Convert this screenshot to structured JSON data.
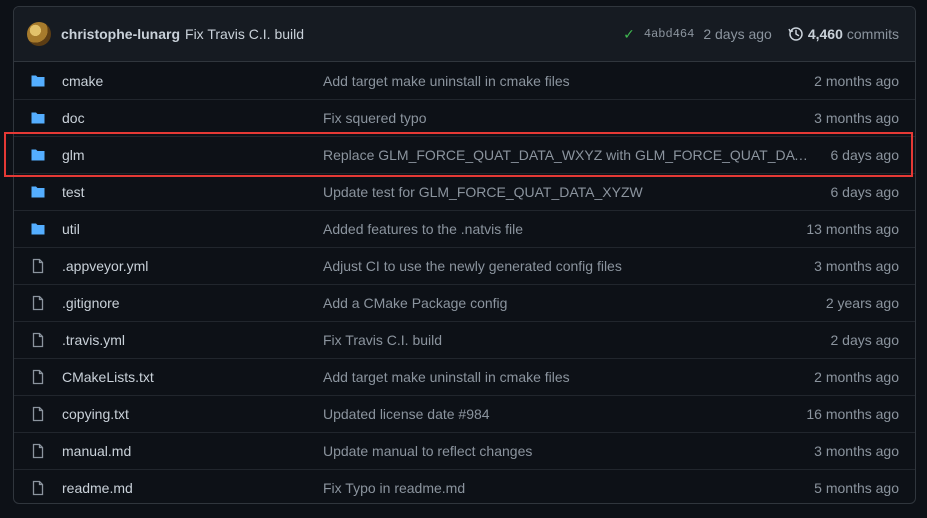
{
  "commit": {
    "author": "christophe-lunarg",
    "message": "Fix Travis C.I. build",
    "sha": "4abd464",
    "time": "2 days ago",
    "commit_count": "4,460",
    "commits_label": "commits"
  },
  "files": [
    {
      "type": "folder",
      "name": "cmake",
      "message": "Add target make uninstall in cmake files",
      "time": "2 months ago"
    },
    {
      "type": "folder",
      "name": "doc",
      "message": "Fix squered typo",
      "time": "3 months ago"
    },
    {
      "type": "folder",
      "name": "glm",
      "message": "Replace GLM_FORCE_QUAT_DATA_WXYZ with GLM_FORCE_QUAT_DATA_...",
      "time": "6 days ago"
    },
    {
      "type": "folder",
      "name": "test",
      "message": "Update test for GLM_FORCE_QUAT_DATA_XYZW",
      "time": "6 days ago"
    },
    {
      "type": "folder",
      "name": "util",
      "message": "Added features to the .natvis file",
      "time": "13 months ago"
    },
    {
      "type": "file",
      "name": ".appveyor.yml",
      "message": "Adjust CI to use the newly generated config files",
      "time": "3 months ago"
    },
    {
      "type": "file",
      "name": ".gitignore",
      "message": "Add a CMake Package config",
      "time": "2 years ago"
    },
    {
      "type": "file",
      "name": ".travis.yml",
      "message": "Fix Travis C.I. build",
      "time": "2 days ago"
    },
    {
      "type": "file",
      "name": "CMakeLists.txt",
      "message": "Add target make uninstall in cmake files",
      "time": "2 months ago"
    },
    {
      "type": "file",
      "name": "copying.txt",
      "message": "Updated license date #984",
      "time": "16 months ago"
    },
    {
      "type": "file",
      "name": "manual.md",
      "message": "Update manual to reflect changes",
      "time": "3 months ago"
    },
    {
      "type": "file",
      "name": "readme.md",
      "message": "Fix Typo in readme.md",
      "time": "5 months ago"
    }
  ],
  "colors": {
    "folder": "#54aeff",
    "file": "#8b949e",
    "check": "#3fb950",
    "highlight": "#e53935"
  }
}
